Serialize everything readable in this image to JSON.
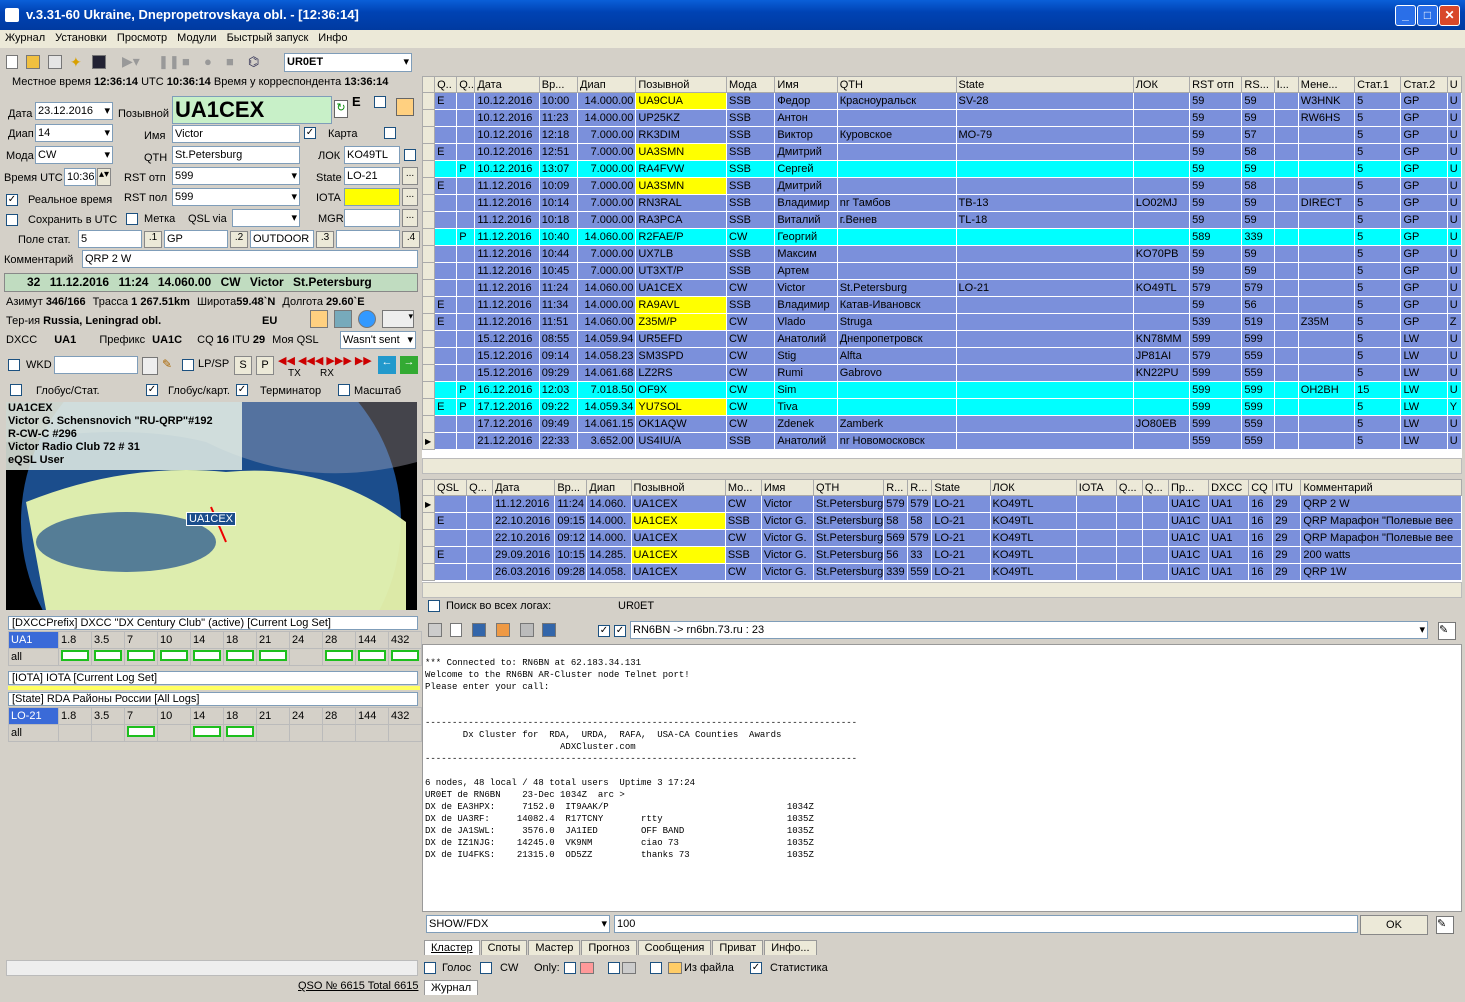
{
  "window": {
    "title": "v.3.31-60 Ukraine, Dnepropetrovskaya obl. - [12:36:14]"
  },
  "menu": [
    "Журнал",
    "Установки",
    "Просмотр",
    "Модули",
    "Быстрый запуск",
    "Инфо"
  ],
  "toolbar": {
    "call_select": "UR0ET"
  },
  "times": {
    "local_label": "Местное время",
    "local": "12:36:14",
    "utc_label": "UTC",
    "utc": "10:36:14",
    "corr_label": "Время у корреспондента",
    "corr": "13:36:14"
  },
  "form": {
    "date_label": "Дата",
    "date": "23.12.2016",
    "band_label": "Диап",
    "band": "14",
    "mode_label": "Мода",
    "mode": "CW",
    "utc_label": "Время UTC",
    "utc": "10:36",
    "call_label": "Позывной",
    "call": "UA1CEX",
    "e_label": "E",
    "name_label": "Имя",
    "name": "Victor",
    "map_label": "Карта",
    "qth_label": "QTH",
    "qth": "St.Petersburg",
    "loc_label": "ЛОК",
    "loc": "KO49TL",
    "rst_s_label": "RST отп",
    "rst_s": "599",
    "state_label": "State",
    "state": "LO-21",
    "rst_r_label": "RST пол",
    "rst_r": "599",
    "iota_label": "IOTA",
    "iota": "",
    "realtime_label": "Реальное время",
    "save_utc_label": "Сохранить в UTC",
    "mark_label": "Метка",
    "qslvia_label": "QSL via",
    "qslvia": "",
    "mgr_label": "MGR",
    "mgr": "",
    "stat_label": "Поле стат.",
    "stat1": "5",
    "b1": ".1",
    "stat2": "GP",
    "b2": ".2",
    "stat3": "OUTDOOR",
    "b3": ".3",
    "stat4": "",
    "b4": ".4",
    "comment_label": "Комментарий",
    "comment": "QRP 2 W"
  },
  "info": {
    "count": "32",
    "date": "11.12.2016",
    "time": "11:24",
    "freq": "14.060.00",
    "mode": "CW",
    "name": "Victor",
    "qth": "St.Petersburg",
    "az_label": "Азимут",
    "az": "346/166",
    "dist_label": "Трасса",
    "dist": "1 267.51km",
    "lat_label": "Широта",
    "lat": "59.48`N",
    "lon_label": "Долгота",
    "lon": "29.60`E",
    "ter_label": "Тер-ия",
    "ter": "Russia, Leningrad obl.",
    "cont": "EU",
    "dxcc_label": "DXCC",
    "dxcc": "UA1",
    "pref_label": "Префикс",
    "pref": "UA1C",
    "cq_label": "CQ",
    "cq": "16",
    "itu_label": "ITU",
    "itu": "29",
    "myqsl_label": "Моя QSL",
    "myqsl": "Wasn't sent",
    "wkd_label": "WKD",
    "lpsp_label": "LP/SP",
    "s": "S",
    "p": "P",
    "tx": "TX",
    "rx": "RX",
    "globe_label": "Глобус/Стат.",
    "globe_map_label": "Глобус/карт.",
    "term_label": "Терминатор",
    "scale_label": "Масштаб"
  },
  "globe": {
    "lines": [
      "UA1CEX",
      "Victor G. Schensnovich \"RU-QRP\"#192",
      "R-CW-C #296",
      "Victor Radio Club 72 # 31",
      "eQSL User"
    ],
    "marker": "UA1CEX"
  },
  "dxcc_panel": {
    "header": "[DXCCPrefix] DXCC \"DX Century Club\" (active) [Current Log Set]",
    "bands": [
      "UA1",
      "1.8",
      "3.5",
      "7",
      "10",
      "14",
      "18",
      "21",
      "24",
      "28",
      "144",
      "432"
    ],
    "row2": "all"
  },
  "iota_panel": {
    "header": "[IOTA] IOTA [Current Log Set]"
  },
  "state_panel": {
    "header": "[State] RDA Районы России [All Logs]",
    "bands": [
      "LO-21",
      "1.8",
      "3.5",
      "7",
      "10",
      "14",
      "18",
      "21",
      "24",
      "28",
      "144",
      "432"
    ],
    "row2": "all"
  },
  "status": {
    "qso": "QSO № 6615 Total 6615"
  },
  "log_table": {
    "headers": [
      "Q..",
      "Q..",
      "Дата",
      "Вр...",
      "Диап",
      "Позывной",
      "Мода",
      "Имя",
      "QTH",
      "State",
      "ЛОК",
      "RST отп",
      "RS...",
      "I...",
      "Мене...",
      "Стат.1",
      "Стат.2",
      "U"
    ],
    "rows": [
      [
        "E",
        "",
        "10.12.2016",
        "10:00",
        "14.000.00",
        "UA9CUA",
        "SSB",
        "Федор",
        "Красноуральск",
        "SV-28",
        "",
        "59",
        "59",
        "",
        "W3HNK",
        "5",
        "GP",
        "U"
      ],
      [
        "",
        "",
        "10.12.2016",
        "11:23",
        "14.000.00",
        "UP25KZ",
        "SSB",
        "Антон",
        "",
        "",
        "",
        "59",
        "59",
        "",
        "RW6HS",
        "5",
        "GP",
        "U"
      ],
      [
        "",
        "",
        "10.12.2016",
        "12:18",
        "7.000.00",
        "RK3DIM",
        "SSB",
        "Виктор",
        "Куровское",
        "MO-79",
        "",
        "59",
        "57",
        "",
        "",
        "5",
        "GP",
        "U"
      ],
      [
        "E",
        "",
        "10.12.2016",
        "12:51",
        "7.000.00",
        "UA3SMN",
        "SSB",
        "Дмитрий",
        "",
        "",
        "",
        "59",
        "58",
        "",
        "",
        "5",
        "GP",
        "U"
      ],
      [
        "",
        "P",
        "10.12.2016",
        "13:07",
        "7.000.00",
        "RA4FVW",
        "SSB",
        "Сергей",
        "",
        "",
        "",
        "59",
        "59",
        "",
        "",
        "5",
        "GP",
        "U"
      ],
      [
        "E",
        "",
        "11.12.2016",
        "10:09",
        "7.000.00",
        "UA3SMN",
        "SSB",
        "Дмитрий",
        "",
        "",
        "",
        "59",
        "58",
        "",
        "",
        "5",
        "GP",
        "U"
      ],
      [
        "",
        "",
        "11.12.2016",
        "10:14",
        "7.000.00",
        "RN3RAL",
        "SSB",
        "Владимир",
        "nr Тамбов",
        "TB-13",
        "LO02MJ",
        "59",
        "59",
        "",
        "DIRECT",
        "5",
        "GP",
        "U"
      ],
      [
        "",
        "",
        "11.12.2016",
        "10:18",
        "7.000.00",
        "RA3PCA",
        "SSB",
        "Виталий",
        "г.Венев",
        "TL-18",
        "",
        "59",
        "59",
        "",
        "",
        "5",
        "GP",
        "U"
      ],
      [
        "",
        "P",
        "11.12.2016",
        "10:40",
        "14.060.00",
        "R2FAE/P",
        "CW",
        "Георгий",
        "",
        "",
        "",
        "589",
        "339",
        "",
        "",
        "5",
        "GP",
        "U"
      ],
      [
        "",
        "",
        "11.12.2016",
        "10:44",
        "7.000.00",
        "UX7LB",
        "SSB",
        "Максим",
        "",
        "",
        "KO70PB",
        "59",
        "59",
        "",
        "",
        "5",
        "GP",
        "U"
      ],
      [
        "",
        "",
        "11.12.2016",
        "10:45",
        "7.000.00",
        "UT3XT/P",
        "SSB",
        "Артем",
        "",
        "",
        "",
        "59",
        "59",
        "",
        "",
        "5",
        "GP",
        "U"
      ],
      [
        "",
        "",
        "11.12.2016",
        "11:24",
        "14.060.00",
        "UA1CEX",
        "CW",
        "Victor",
        "St.Petersburg",
        "LO-21",
        "KO49TL",
        "579",
        "579",
        "",
        "",
        "5",
        "GP",
        "U"
      ],
      [
        "E",
        "",
        "11.12.2016",
        "11:34",
        "14.000.00",
        "RA9AVL",
        "SSB",
        "Владимир",
        "Катав-Ивановск",
        "",
        "",
        "59",
        "56",
        "",
        "",
        "5",
        "GP",
        "U"
      ],
      [
        "E",
        "",
        "11.12.2016",
        "11:51",
        "14.060.00",
        "Z35M/P",
        "CW",
        "Vlado",
        "Struga",
        "",
        "",
        "539",
        "519",
        "",
        "Z35M",
        "5",
        "GP",
        "Z"
      ],
      [
        "",
        "",
        "15.12.2016",
        "08:55",
        "14.059.94",
        "UR5EFD",
        "CW",
        "Анатолий",
        "Днепропетровск",
        "",
        "KN78MM",
        "599",
        "599",
        "",
        "",
        "5",
        "LW",
        "U"
      ],
      [
        "",
        "",
        "15.12.2016",
        "09:14",
        "14.058.23",
        "SM3SPD",
        "CW",
        "Stig",
        "Alfta",
        "",
        "JP81AI",
        "579",
        "559",
        "",
        "",
        "5",
        "LW",
        "U"
      ],
      [
        "",
        "",
        "15.12.2016",
        "09:29",
        "14.061.68",
        "LZ2RS",
        "CW",
        "Rumi",
        "Gabrovo",
        "",
        "KN22PU",
        "599",
        "559",
        "",
        "",
        "5",
        "LW",
        "U"
      ],
      [
        "",
        "P",
        "16.12.2016",
        "12:03",
        "7.018.50",
        "OF9X",
        "CW",
        "Sim",
        "",
        "",
        "",
        "599",
        "599",
        "",
        "OH2BH",
        "15",
        "LW",
        "U"
      ],
      [
        "E",
        "P",
        "17.12.2016",
        "09:22",
        "14.059.34",
        "YU7SOL",
        "CW",
        "Tiva",
        "",
        "",
        "",
        "599",
        "599",
        "",
        "",
        "5",
        "LW",
        "Y"
      ],
      [
        "",
        "",
        "17.12.2016",
        "09:49",
        "14.061.15",
        "OK1AQW",
        "CW",
        "Zdenek",
        "Zamberk",
        "",
        "JO80EB",
        "599",
        "559",
        "",
        "",
        "5",
        "LW",
        "U"
      ],
      [
        "",
        "",
        "21.12.2016",
        "22:33",
        "3.652.00",
        "US4IU/A",
        "SSB",
        "Анатолий",
        "nr Новомосковск",
        "",
        "",
        "559",
        "559",
        "",
        "",
        "5",
        "LW",
        "U"
      ]
    ],
    "cyan_rows": [
      4,
      8,
      17,
      18
    ],
    "yellow_call_rows": [
      0,
      3,
      5,
      12,
      13,
      18
    ]
  },
  "prev_table": {
    "headers": [
      "QSL",
      "Q...",
      "Дата",
      "Вр...",
      "Диап",
      "Позывной",
      "Мо...",
      "Имя",
      "QTH",
      "R...",
      "R...",
      "State",
      "ЛОК",
      "IOTA",
      "Q...",
      "Q...",
      "Пр...",
      "DXCC",
      "CQ",
      "ITU",
      "Комментарий"
    ],
    "rows": [
      [
        "",
        "",
        "11.12.2016",
        "11:24",
        "14.060.",
        "UA1CEX",
        "CW",
        "Victor",
        "St.Petersburg",
        "579",
        "579",
        "LO-21",
        "KO49TL",
        "",
        "",
        "",
        "UA1C",
        "UA1",
        "16",
        "29",
        "QRP 2 W"
      ],
      [
        "E",
        "",
        "22.10.2016",
        "09:15",
        "14.000.",
        "UA1CEX",
        "SSB",
        "Victor G.",
        "St.Petersburg",
        "58",
        "58",
        "LO-21",
        "KO49TL",
        "",
        "",
        "",
        "UA1C",
        "UA1",
        "16",
        "29",
        "QRP Марафон \"Полевые вее"
      ],
      [
        "",
        "",
        "22.10.2016",
        "09:12",
        "14.000.",
        "UA1CEX",
        "CW",
        "Victor G.",
        "St.Petersburg",
        "569",
        "579",
        "LO-21",
        "KO49TL",
        "",
        "",
        "",
        "UA1C",
        "UA1",
        "16",
        "29",
        "QRP Марафон \"Полевые вее"
      ],
      [
        "E",
        "",
        "29.09.2016",
        "10:15",
        "14.285.",
        "UA1CEX",
        "SSB",
        "Victor G.",
        "St.Petersburg",
        "56",
        "33",
        "LO-21",
        "KO49TL",
        "",
        "",
        "",
        "UA1C",
        "UA1",
        "16",
        "29",
        "200 watts"
      ],
      [
        "",
        "",
        "26.03.2016",
        "09:28",
        "14.058.",
        "UA1CEX",
        "CW",
        "Victor G.",
        "St.Petersburg",
        "339",
        "559",
        "LO-21",
        "KO49TL",
        "",
        "",
        "",
        "UA1C",
        "UA1",
        "16",
        "29",
        "QRP 1W"
      ]
    ],
    "yellow_call_rows": [
      1,
      3
    ]
  },
  "search": {
    "label": "Поиск во всех логах:",
    "call": "UR0ET"
  },
  "cluster": {
    "node": "RN6BN -> rn6bn.73.ru : 23",
    "text": "*** Connected to: RN6BN at 62.183.34.131\nWelcome to the RN6BN AR-Cluster node Telnet port!\nPlease enter your call:\n\n\n--------------------------------------------------------------------------------\n       Dx Cluster for  RDA,  URDA,  RAFA,  USA-CA Counties  Awards\n                         ADXCluster.com\n--------------------------------------------------------------------------------\n\n6 nodes, 48 local / 48 total users  Uptime 3 17:24\nUR0ET de RN6BN    23-Dec 1034Z  arc >\nDX de EA3HPX:     7152.0  IT9AAK/P                                 1034Z\nDX de UA3RF:     14082.4  R17TCNY       rtty                       1035Z\nDX de JA1SWL:     3576.0  JA1IED        OFF BAND                   1035Z\nDX de IZ1NJG:    14245.0  VK9NM         ciao 73                    1035Z\nDX de IU4FKS:    21315.0  OD5ZZ         thanks 73                  1035Z",
    "cmd": "SHOW/FDX",
    "cmd_arg": "100",
    "ok": "OK",
    "tabs": [
      "Кластер",
      "Споты",
      "Мастер",
      "Прогноз",
      "Сообщения",
      "Приват",
      "Инфо..."
    ],
    "voice": "Голос",
    "cw": "CW",
    "only": "Only:",
    "from_file": "Из файла",
    "stat": "Статистика",
    "journal_tab": "Журнал"
  }
}
